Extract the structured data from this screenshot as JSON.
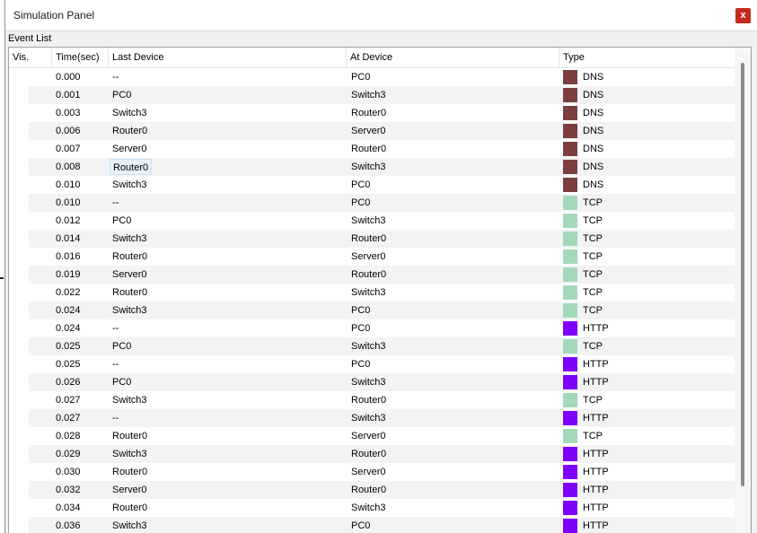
{
  "window": {
    "title": "Simulation Panel",
    "close_label": "x"
  },
  "event_list": {
    "label": "Event List",
    "columns": [
      "Vis.",
      "Time(sec)",
      "Last Device",
      "At Device",
      "Type"
    ],
    "colors": {
      "DNS": "#7b3f3f",
      "TCP": "#a3d9b8",
      "HTTP": "#8000ff"
    },
    "rows": [
      {
        "time": "0.000",
        "last": "--",
        "at": "PC0",
        "type": "DNS"
      },
      {
        "time": "0.001",
        "last": "PC0",
        "at": "Switch3",
        "type": "DNS"
      },
      {
        "time": "0.003",
        "last": "Switch3",
        "at": "Router0",
        "type": "DNS"
      },
      {
        "time": "0.006",
        "last": "Router0",
        "at": "Server0",
        "type": "DNS"
      },
      {
        "time": "0.007",
        "last": "Server0",
        "at": "Router0",
        "type": "DNS"
      },
      {
        "time": "0.008",
        "last": "Router0",
        "at": "Switch3",
        "type": "DNS",
        "selected": true
      },
      {
        "time": "0.010",
        "last": "Switch3",
        "at": "PC0",
        "type": "DNS"
      },
      {
        "time": "0.010",
        "last": "--",
        "at": "PC0",
        "type": "TCP"
      },
      {
        "time": "0.012",
        "last": "PC0",
        "at": "Switch3",
        "type": "TCP"
      },
      {
        "time": "0.014",
        "last": "Switch3",
        "at": "Router0",
        "type": "TCP"
      },
      {
        "time": "0.016",
        "last": "Router0",
        "at": "Server0",
        "type": "TCP"
      },
      {
        "time": "0.019",
        "last": "Server0",
        "at": "Router0",
        "type": "TCP"
      },
      {
        "time": "0.022",
        "last": "Router0",
        "at": "Switch3",
        "type": "TCP"
      },
      {
        "time": "0.024",
        "last": "Switch3",
        "at": "PC0",
        "type": "TCP"
      },
      {
        "time": "0.024",
        "last": "--",
        "at": "PC0",
        "type": "HTTP"
      },
      {
        "time": "0.025",
        "last": "PC0",
        "at": "Switch3",
        "type": "TCP"
      },
      {
        "time": "0.025",
        "last": "--",
        "at": "PC0",
        "type": "HTTP"
      },
      {
        "time": "0.026",
        "last": "PC0",
        "at": "Switch3",
        "type": "HTTP"
      },
      {
        "time": "0.027",
        "last": "Switch3",
        "at": "Router0",
        "type": "TCP"
      },
      {
        "time": "0.027",
        "last": "--",
        "at": "Switch3",
        "type": "HTTP"
      },
      {
        "time": "0.028",
        "last": "Router0",
        "at": "Server0",
        "type": "TCP"
      },
      {
        "time": "0.029",
        "last": "Switch3",
        "at": "Router0",
        "type": "HTTP"
      },
      {
        "time": "0.030",
        "last": "Router0",
        "at": "Server0",
        "type": "HTTP"
      },
      {
        "time": "0.032",
        "last": "Server0",
        "at": "Router0",
        "type": "HTTP"
      },
      {
        "time": "0.034",
        "last": "Router0",
        "at": "Switch3",
        "type": "HTTP"
      },
      {
        "time": "0.036",
        "last": "Switch3",
        "at": "PC0",
        "type": "HTTP"
      }
    ]
  }
}
